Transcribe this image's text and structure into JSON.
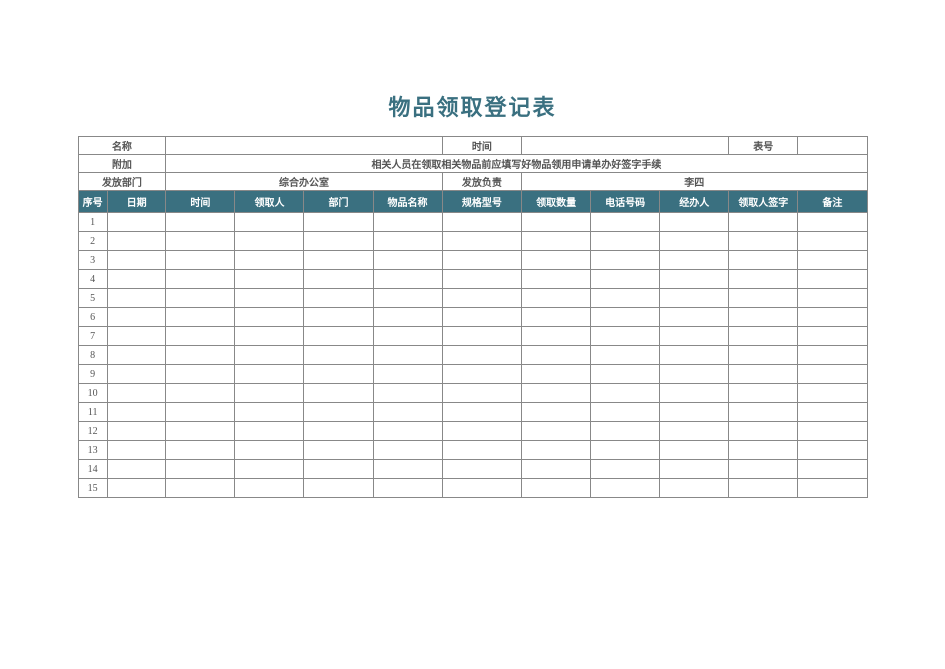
{
  "title": "物品领取登记表",
  "info": {
    "row1": {
      "name_label": "名称",
      "name_value": "",
      "time_label": "时间",
      "time_value": "",
      "number_label": "表号",
      "number_value": ""
    },
    "row2": {
      "note_label": "附加",
      "note_value": "相关人员在领取相关物品前应填写好物品领用申请单办好签字手续"
    },
    "row3": {
      "dept_label": "发放部门",
      "dept_value": "综合办公室",
      "leader_label": "发放负责",
      "leader_value": "李四"
    }
  },
  "headers": {
    "seq": "序号",
    "date": "日期",
    "time": "时间",
    "requester": "领取人",
    "dept": "部门",
    "item": "物品名称",
    "spec": "规格型号",
    "qty": "领取数量",
    "phone": "电话号码",
    "handler": "经办人",
    "sign": "领取人签字",
    "remark": "备注"
  },
  "rows": [
    {
      "seq": "1"
    },
    {
      "seq": "2"
    },
    {
      "seq": "3"
    },
    {
      "seq": "4"
    },
    {
      "seq": "5"
    },
    {
      "seq": "6"
    },
    {
      "seq": "7"
    },
    {
      "seq": "8"
    },
    {
      "seq": "9"
    },
    {
      "seq": "10"
    },
    {
      "seq": "11"
    },
    {
      "seq": "12"
    },
    {
      "seq": "13"
    },
    {
      "seq": "14"
    },
    {
      "seq": "15"
    }
  ]
}
